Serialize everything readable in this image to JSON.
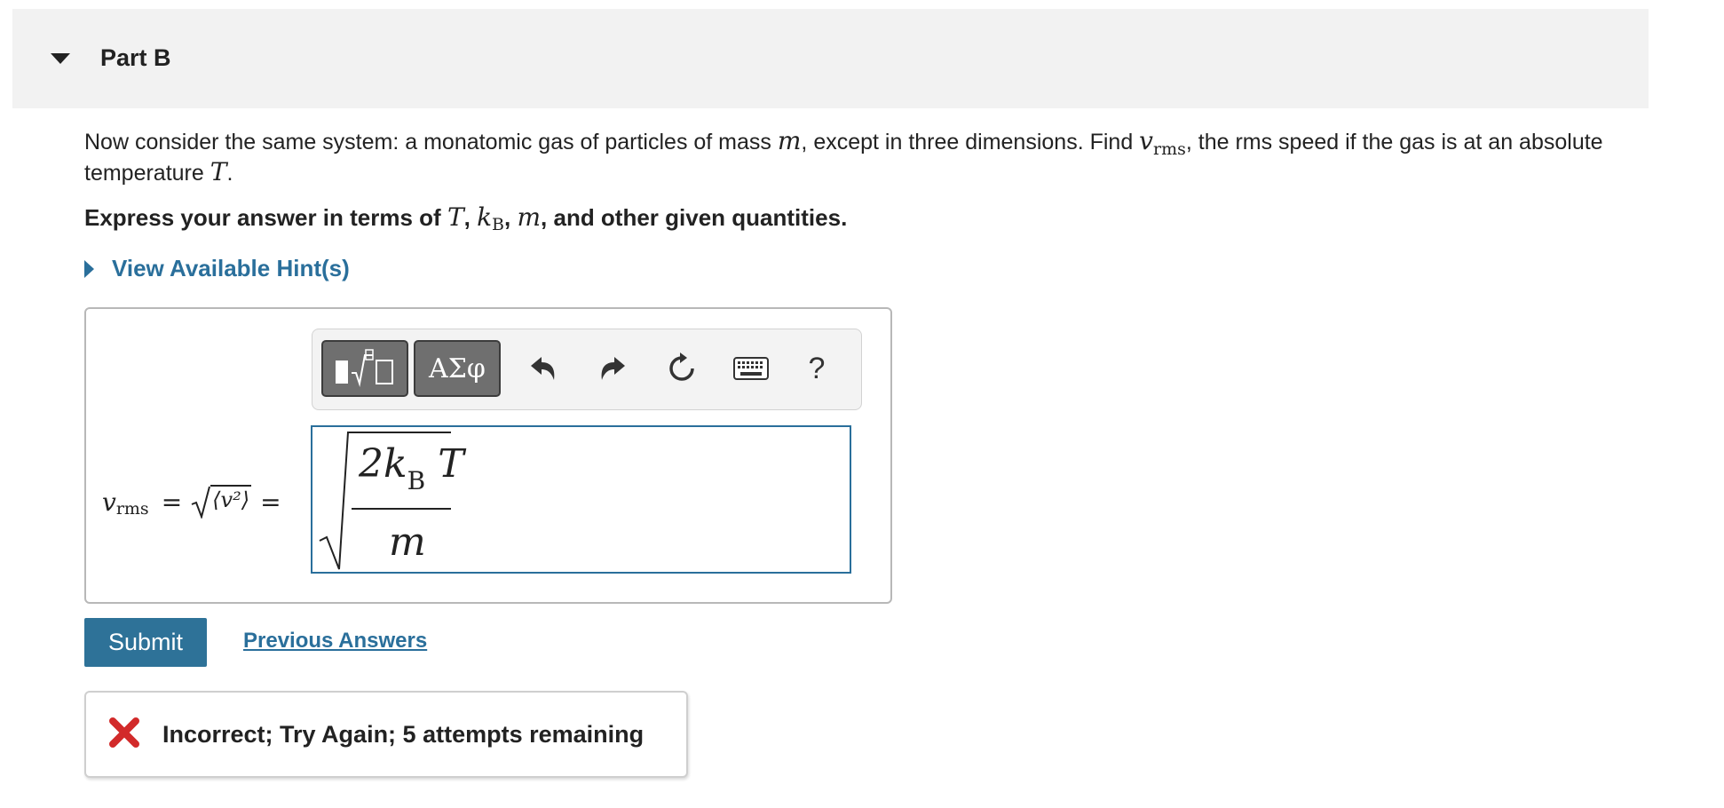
{
  "header": {
    "title": "Part B"
  },
  "question": {
    "text_1": "Now consider the same system: a monatomic gas of particles of mass ",
    "var_m": "m",
    "text_2": ", except in three dimensions. Find ",
    "var_v": "v",
    "sub_rms": "rms",
    "text_3": ", the rms speed if the gas is at an absolute temperature ",
    "var_T": "T",
    "text_4": ".",
    "instruction_prefix": "Express your answer in terms of ",
    "instr_T": "T",
    "instr_sep1": ", ",
    "instr_k": "k",
    "instr_kB_sub": "B",
    "instr_sep2": ", ",
    "instr_m": "m",
    "instruction_suffix": ", and other given quantities."
  },
  "hints": {
    "label": "View Available Hint(s)"
  },
  "toolbar": {
    "templates_label": "templates",
    "symbols_label": "ΑΣφ",
    "help_label": "?"
  },
  "answer": {
    "lhs_v": "v",
    "lhs_sub": "rms",
    "lhs_eq1": "=",
    "lhs_expr": "⟨v²⟩",
    "lhs_eq2": "=",
    "input_numerator_prefix": "2k",
    "input_numerator_sub": "B",
    "input_numerator_suffix": " T",
    "input_denominator": "m"
  },
  "actions": {
    "submit_label": "Submit",
    "previous_answers_label": "Previous Answers"
  },
  "feedback": {
    "message": "Incorrect; Try Again; 5 attempts remaining",
    "status_color": "#d22a2a"
  },
  "colors": {
    "accent": "#2a6f9b",
    "submit_bg": "#2e7298",
    "header_bg": "#f2f2f2"
  }
}
